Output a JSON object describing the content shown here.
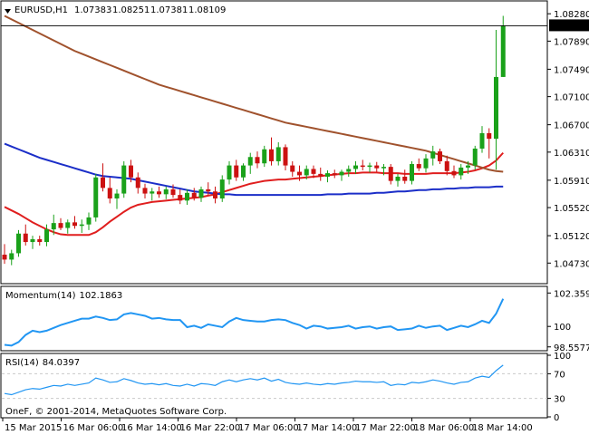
{
  "header": {
    "symbol_timeframe": "EURUSD,H1",
    "open": "1.07383",
    "high": "1.08251",
    "low": "1.07381",
    "close": "1.08109"
  },
  "colors": {
    "background": "#ffffff",
    "frame": "#000000",
    "bull_candle": "#1aa11a",
    "bear_candle": "#cc1111",
    "ma_fast": "#e01e1e",
    "ma_slow": "#a0522d",
    "ma_long": "#1b2ec8",
    "indicator_line": "#2196f3",
    "grid": "#c9c9c9"
  },
  "chart_data": [
    {
      "type": "candlestick",
      "title": "EURUSD,H1",
      "ylim": [
        1.0445,
        1.0845
      ],
      "yticks": [
        "1.08280",
        "1.07890",
        "1.07490",
        "1.07100",
        "1.06700",
        "1.06310",
        "1.05910",
        "1.05520",
        "1.05120",
        "1.04730"
      ],
      "current_price_label": "1.08109",
      "current_price": 1.08109,
      "xticks": [
        "15 Mar 2015",
        "16 Mar 06:00",
        "16 Mar 14:00",
        "16 Mar 22:00",
        "17 Mar 06:00",
        "17 Mar 14:00",
        "17 Mar 22:00",
        "18 Mar 06:00",
        "18 Mar 14:00"
      ],
      "candles": [
        {
          "o": 1.0485,
          "h": 1.05,
          "l": 1.0472,
          "c": 1.0478
        },
        {
          "o": 1.0478,
          "h": 1.0492,
          "l": 1.047,
          "c": 1.0487
        },
        {
          "o": 1.0487,
          "h": 1.052,
          "l": 1.0482,
          "c": 1.0515
        },
        {
          "o": 1.0515,
          "h": 1.0528,
          "l": 1.0498,
          "c": 1.0503
        },
        {
          "o": 1.0503,
          "h": 1.0512,
          "l": 1.0493,
          "c": 1.0507
        },
        {
          "o": 1.0507,
          "h": 1.0512,
          "l": 1.0498,
          "c": 1.0503
        },
        {
          "o": 1.0503,
          "h": 1.0528,
          "l": 1.0497,
          "c": 1.0521
        },
        {
          "o": 1.0521,
          "h": 1.0542,
          "l": 1.0513,
          "c": 1.053
        },
        {
          "o": 1.053,
          "h": 1.0537,
          "l": 1.052,
          "c": 1.0523
        },
        {
          "o": 1.0523,
          "h": 1.0535,
          "l": 1.0515,
          "c": 1.0531
        },
        {
          "o": 1.0531,
          "h": 1.054,
          "l": 1.0522,
          "c": 1.0526
        },
        {
          "o": 1.0526,
          "h": 1.0535,
          "l": 1.0516,
          "c": 1.0528
        },
        {
          "o": 1.0528,
          "h": 1.0545,
          "l": 1.052,
          "c": 1.0538
        },
        {
          "o": 1.0538,
          "h": 1.06,
          "l": 1.0532,
          "c": 1.0595
        },
        {
          "o": 1.0595,
          "h": 1.0615,
          "l": 1.0575,
          "c": 1.058
        },
        {
          "o": 1.058,
          "h": 1.0595,
          "l": 1.0558,
          "c": 1.0565
        },
        {
          "o": 1.0565,
          "h": 1.0578,
          "l": 1.055,
          "c": 1.0572
        },
        {
          "o": 1.0572,
          "h": 1.0618,
          "l": 1.0566,
          "c": 1.0612
        },
        {
          "o": 1.0612,
          "h": 1.062,
          "l": 1.0588,
          "c": 1.0595
        },
        {
          "o": 1.0595,
          "h": 1.0602,
          "l": 1.0572,
          "c": 1.058
        },
        {
          "o": 1.058,
          "h": 1.0586,
          "l": 1.0565,
          "c": 1.0572
        },
        {
          "o": 1.0572,
          "h": 1.058,
          "l": 1.0562,
          "c": 1.0575
        },
        {
          "o": 1.0575,
          "h": 1.0582,
          "l": 1.0566,
          "c": 1.0571
        },
        {
          "o": 1.0571,
          "h": 1.0582,
          "l": 1.0564,
          "c": 1.0578
        },
        {
          "o": 1.0578,
          "h": 1.0585,
          "l": 1.0566,
          "c": 1.057
        },
        {
          "o": 1.057,
          "h": 1.0578,
          "l": 1.0557,
          "c": 1.0562
        },
        {
          "o": 1.0562,
          "h": 1.0578,
          "l": 1.0556,
          "c": 1.0573
        },
        {
          "o": 1.0573,
          "h": 1.058,
          "l": 1.0562,
          "c": 1.0566
        },
        {
          "o": 1.0566,
          "h": 1.0582,
          "l": 1.056,
          "c": 1.0578
        },
        {
          "o": 1.0578,
          "h": 1.0588,
          "l": 1.057,
          "c": 1.0575
        },
        {
          "o": 1.0575,
          "h": 1.0582,
          "l": 1.0558,
          "c": 1.0565
        },
        {
          "o": 1.0565,
          "h": 1.0598,
          "l": 1.056,
          "c": 1.0592
        },
        {
          "o": 1.0592,
          "h": 1.0618,
          "l": 1.0585,
          "c": 1.0612
        },
        {
          "o": 1.0612,
          "h": 1.062,
          "l": 1.059,
          "c": 1.0595
        },
        {
          "o": 1.0595,
          "h": 1.0615,
          "l": 1.059,
          "c": 1.0612
        },
        {
          "o": 1.0612,
          "h": 1.063,
          "l": 1.06,
          "c": 1.0624
        },
        {
          "o": 1.0624,
          "h": 1.0632,
          "l": 1.0608,
          "c": 1.0615
        },
        {
          "o": 1.0615,
          "h": 1.064,
          "l": 1.061,
          "c": 1.0635
        },
        {
          "o": 1.0635,
          "h": 1.0652,
          "l": 1.0612,
          "c": 1.0618
        },
        {
          "o": 1.0618,
          "h": 1.0645,
          "l": 1.0612,
          "c": 1.0638
        },
        {
          "o": 1.0638,
          "h": 1.0642,
          "l": 1.0605,
          "c": 1.0612
        },
        {
          "o": 1.0612,
          "h": 1.0618,
          "l": 1.0596,
          "c": 1.0603
        },
        {
          "o": 1.0603,
          "h": 1.0612,
          "l": 1.059,
          "c": 1.0598
        },
        {
          "o": 1.0598,
          "h": 1.0612,
          "l": 1.0592,
          "c": 1.0607
        },
        {
          "o": 1.0607,
          "h": 1.0612,
          "l": 1.0594,
          "c": 1.06
        },
        {
          "o": 1.06,
          "h": 1.0609,
          "l": 1.059,
          "c": 1.0596
        },
        {
          "o": 1.0596,
          "h": 1.0605,
          "l": 1.0588,
          "c": 1.0601
        },
        {
          "o": 1.0601,
          "h": 1.0606,
          "l": 1.0594,
          "c": 1.0598
        },
        {
          "o": 1.0598,
          "h": 1.0606,
          "l": 1.059,
          "c": 1.0603
        },
        {
          "o": 1.0603,
          "h": 1.0612,
          "l": 1.0596,
          "c": 1.0607
        },
        {
          "o": 1.0607,
          "h": 1.0618,
          "l": 1.06,
          "c": 1.0612
        },
        {
          "o": 1.0612,
          "h": 1.062,
          "l": 1.0605,
          "c": 1.061
        },
        {
          "o": 1.061,
          "h": 1.0616,
          "l": 1.0602,
          "c": 1.0612
        },
        {
          "o": 1.0612,
          "h": 1.0617,
          "l": 1.0603,
          "c": 1.0608
        },
        {
          "o": 1.0608,
          "h": 1.0614,
          "l": 1.0598,
          "c": 1.061
        },
        {
          "o": 1.061,
          "h": 1.0614,
          "l": 1.0585,
          "c": 1.059
        },
        {
          "o": 1.059,
          "h": 1.06,
          "l": 1.0582,
          "c": 1.0596
        },
        {
          "o": 1.0596,
          "h": 1.0606,
          "l": 1.0586,
          "c": 1.059
        },
        {
          "o": 1.059,
          "h": 1.0618,
          "l": 1.0585,
          "c": 1.0614
        },
        {
          "o": 1.0614,
          "h": 1.0622,
          "l": 1.0604,
          "c": 1.0608
        },
        {
          "o": 1.0608,
          "h": 1.0628,
          "l": 1.0602,
          "c": 1.0622
        },
        {
          "o": 1.0622,
          "h": 1.064,
          "l": 1.0612,
          "c": 1.0632
        },
        {
          "o": 1.0632,
          "h": 1.0636,
          "l": 1.0614,
          "c": 1.0618
        },
        {
          "o": 1.0618,
          "h": 1.0626,
          "l": 1.0598,
          "c": 1.0604
        },
        {
          "o": 1.0604,
          "h": 1.0612,
          "l": 1.0594,
          "c": 1.0598
        },
        {
          "o": 1.0598,
          "h": 1.0614,
          "l": 1.0592,
          "c": 1.0609
        },
        {
          "o": 1.0609,
          "h": 1.0618,
          "l": 1.06,
          "c": 1.0612
        },
        {
          "o": 1.0612,
          "h": 1.064,
          "l": 1.0606,
          "c": 1.0636
        },
        {
          "o": 1.0636,
          "h": 1.0668,
          "l": 1.063,
          "c": 1.0658
        },
        {
          "o": 1.0658,
          "h": 1.0665,
          "l": 1.0622,
          "c": 1.065
        },
        {
          "o": 1.065,
          "h": 1.0805,
          "l": 1.0606,
          "c": 1.0738
        },
        {
          "o": 1.0738,
          "h": 1.0825,
          "l": 1.0738,
          "c": 1.0811
        }
      ],
      "moving_averages": [
        {
          "color": "#e01e1e",
          "values": [
            1.0553,
            1.0548,
            1.0543,
            1.0537,
            1.0531,
            1.0526,
            1.0521,
            1.0517,
            1.0514,
            1.0513,
            1.0513,
            1.0513,
            1.0513,
            1.0517,
            1.0524,
            1.0532,
            1.0539,
            1.0546,
            1.0552,
            1.0556,
            1.0558,
            1.056,
            1.0561,
            1.0562,
            1.0563,
            1.0564,
            1.0565,
            1.0566,
            1.0567,
            1.0569,
            1.0571,
            1.0574,
            1.0577,
            1.058,
            1.0583,
            1.0586,
            1.0588,
            1.059,
            1.0591,
            1.0592,
            1.0592,
            1.0593,
            1.0594,
            1.0595,
            1.0596,
            1.0597,
            1.0598,
            1.0599,
            1.06,
            1.0601,
            1.0601,
            1.0602,
            1.0602,
            1.0602,
            1.0601,
            1.0601,
            1.0601,
            1.06,
            1.06,
            1.06,
            1.06,
            1.0601,
            1.0601,
            1.0601,
            1.0601,
            1.0602,
            1.0603,
            1.0605,
            1.0608,
            1.0612,
            1.0619,
            1.063
          ]
        },
        {
          "color": "#a0522d",
          "values": [
            1.0825,
            1.082,
            1.0815,
            1.081,
            1.0805,
            1.08,
            1.0795,
            1.079,
            1.0785,
            1.078,
            1.0775,
            1.0771,
            1.0767,
            1.0763,
            1.0759,
            1.0755,
            1.0751,
            1.0747,
            1.0743,
            1.0739,
            1.0735,
            1.0731,
            1.0727,
            1.0724,
            1.0721,
            1.0718,
            1.0715,
            1.0712,
            1.0709,
            1.0706,
            1.0703,
            1.07,
            1.0697,
            1.0694,
            1.0691,
            1.0688,
            1.0685,
            1.0682,
            1.0679,
            1.0676,
            1.0673,
            1.0671,
            1.0669,
            1.0667,
            1.0665,
            1.0663,
            1.0661,
            1.0659,
            1.0657,
            1.0655,
            1.0653,
            1.0651,
            1.0649,
            1.0647,
            1.0645,
            1.0643,
            1.0641,
            1.0639,
            1.0637,
            1.0635,
            1.0633,
            1.063,
            1.0627,
            1.0624,
            1.0621,
            1.0618,
            1.0615,
            1.0612,
            1.0609,
            1.0606,
            1.0604,
            1.0603
          ]
        },
        {
          "color": "#1b2ec8",
          "values": [
            1.0643,
            1.0639,
            1.0635,
            1.0631,
            1.0627,
            1.0623,
            1.062,
            1.0617,
            1.0614,
            1.0611,
            1.0608,
            1.0605,
            1.0602,
            1.0599,
            1.0597,
            1.0596,
            1.0595,
            1.0594,
            1.0593,
            1.0591,
            1.0589,
            1.0587,
            1.0585,
            1.0583,
            1.0581,
            1.0579,
            1.0577,
            1.0575,
            1.0574,
            1.0573,
            1.0572,
            1.0571,
            1.0571,
            1.057,
            1.057,
            1.057,
            1.057,
            1.057,
            1.057,
            1.057,
            1.057,
            1.057,
            1.057,
            1.057,
            1.057,
            1.057,
            1.0571,
            1.0571,
            1.0571,
            1.0572,
            1.0572,
            1.0572,
            1.0572,
            1.0573,
            1.0573,
            1.0574,
            1.0575,
            1.0575,
            1.0576,
            1.0577,
            1.0577,
            1.0578,
            1.0578,
            1.0579,
            1.0579,
            1.058,
            1.058,
            1.0581,
            1.0581,
            1.0581,
            1.0582,
            1.0582
          ]
        }
      ]
    },
    {
      "type": "line",
      "title": "Momentum(14) 102.1863",
      "name_label": "Momentum(14)",
      "value_label": "102.1863",
      "ylim": [
        98.35,
        102.7
      ],
      "yticks": [
        102.3591,
        100,
        98.5577
      ],
      "ytick_labels": [
        "102.3591",
        "100",
        "98.5577"
      ],
      "values": [
        98.7,
        98.65,
        98.9,
        99.4,
        99.7,
        99.6,
        99.7,
        99.9,
        100.1,
        100.25,
        100.4,
        100.55,
        100.55,
        100.7,
        100.6,
        100.45,
        100.5,
        100.85,
        100.95,
        100.85,
        100.75,
        100.55,
        100.6,
        100.5,
        100.45,
        100.45,
        99.95,
        100.05,
        99.9,
        100.15,
        100.05,
        99.95,
        100.35,
        100.6,
        100.45,
        100.4,
        100.35,
        100.35,
        100.45,
        100.5,
        100.45,
        100.25,
        100.1,
        99.85,
        100.05,
        100.0,
        99.85,
        99.9,
        99.95,
        100.05,
        99.85,
        99.95,
        100.0,
        99.85,
        99.95,
        100.0,
        99.75,
        99.8,
        99.85,
        100.05,
        99.9,
        100.0,
        100.05,
        99.75,
        99.9,
        100.05,
        99.95,
        100.15,
        100.4,
        100.25,
        100.9,
        101.95
      ]
    },
    {
      "type": "line",
      "title": "RSI(14) 84.0397",
      "name_label": "RSI(14)",
      "value_label": "84.0397",
      "ylim": [
        0,
        100
      ],
      "yticks": [
        100,
        70,
        30,
        0
      ],
      "ytick_labels": [
        "100",
        "70",
        "30",
        "0"
      ],
      "levels": [
        70,
        30
      ],
      "values": [
        38,
        36,
        40,
        44,
        46,
        45,
        48,
        51,
        50,
        53,
        51,
        53,
        55,
        63,
        60,
        56,
        57,
        62,
        59,
        55,
        53,
        54,
        52,
        54,
        51,
        50,
        53,
        50,
        54,
        53,
        51,
        57,
        60,
        57,
        60,
        62,
        60,
        63,
        58,
        61,
        56,
        54,
        53,
        55,
        53,
        52,
        54,
        53,
        55,
        56,
        58,
        57,
        57,
        56,
        57,
        51,
        53,
        52,
        56,
        55,
        57,
        60,
        58,
        55,
        53,
        56,
        57,
        63,
        66,
        64,
        75,
        84
      ]
    }
  ],
  "footer": {
    "copyright": "OneF, © 2001-2014, MetaQuotes Software Corp."
  }
}
